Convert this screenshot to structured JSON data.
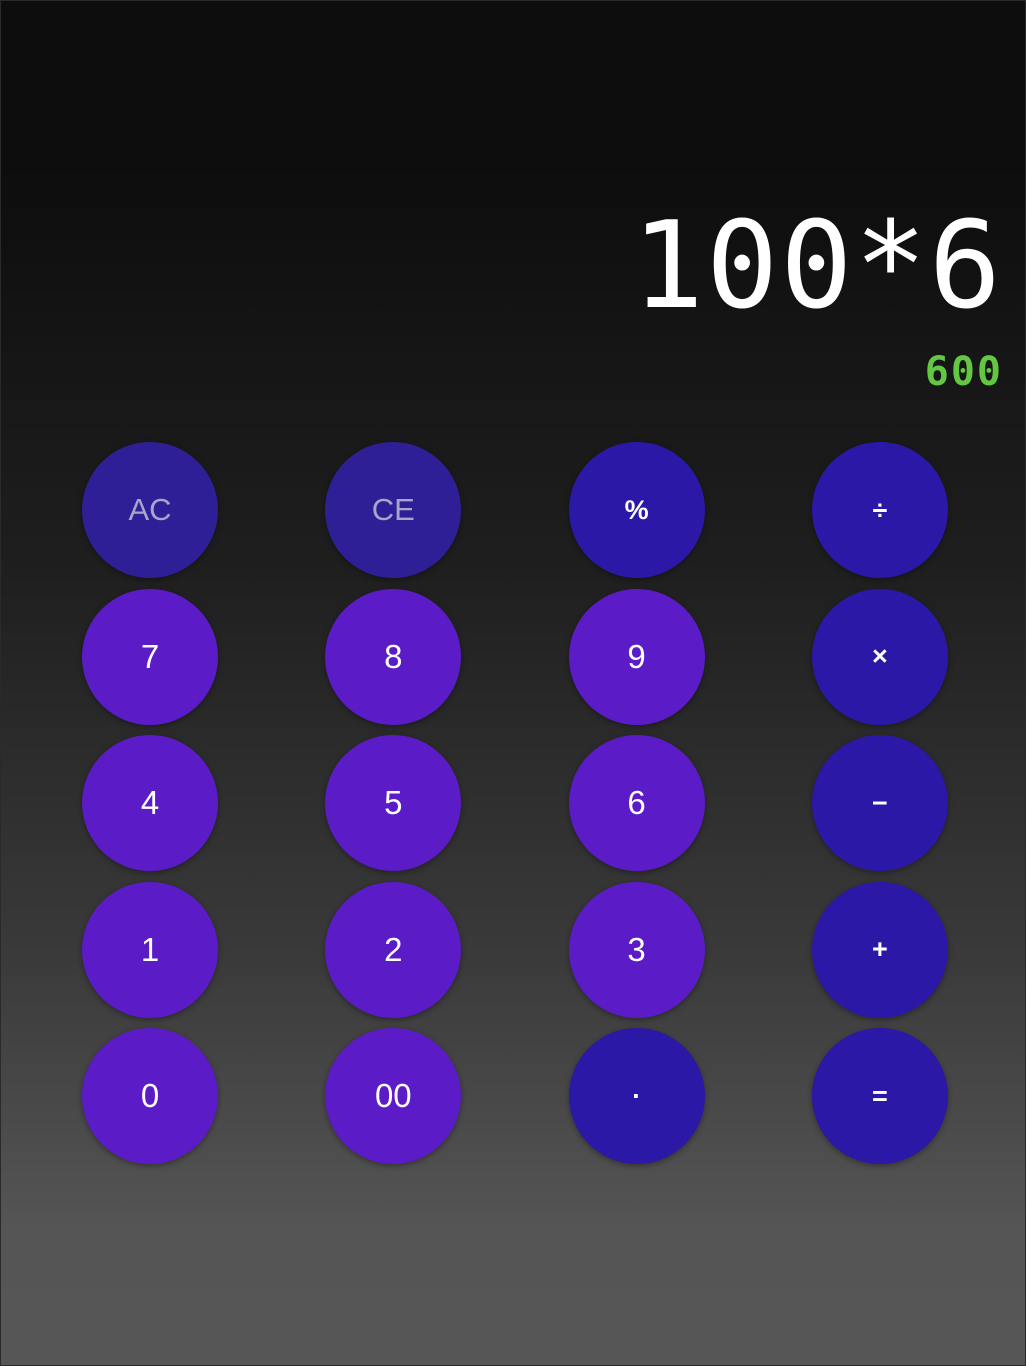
{
  "display": {
    "expression": "100*6",
    "result": "600"
  },
  "colors": {
    "digit_key": "#5b1cc8",
    "operator_key": "#2c18a6",
    "function_key": "#2e1f97",
    "result_text": "#63c741",
    "expression_text": "#ffffff"
  },
  "keys": {
    "ac": "AC",
    "ce": "CE",
    "percent": "%",
    "divide": "÷",
    "seven": "7",
    "eight": "8",
    "nine": "9",
    "multiply": "×",
    "four": "4",
    "five": "5",
    "six": "6",
    "minus": "−",
    "one": "1",
    "two": "2",
    "three": "3",
    "plus": "+",
    "zero": "0",
    "double_zero": "00",
    "decimal": "·",
    "equals": "="
  }
}
